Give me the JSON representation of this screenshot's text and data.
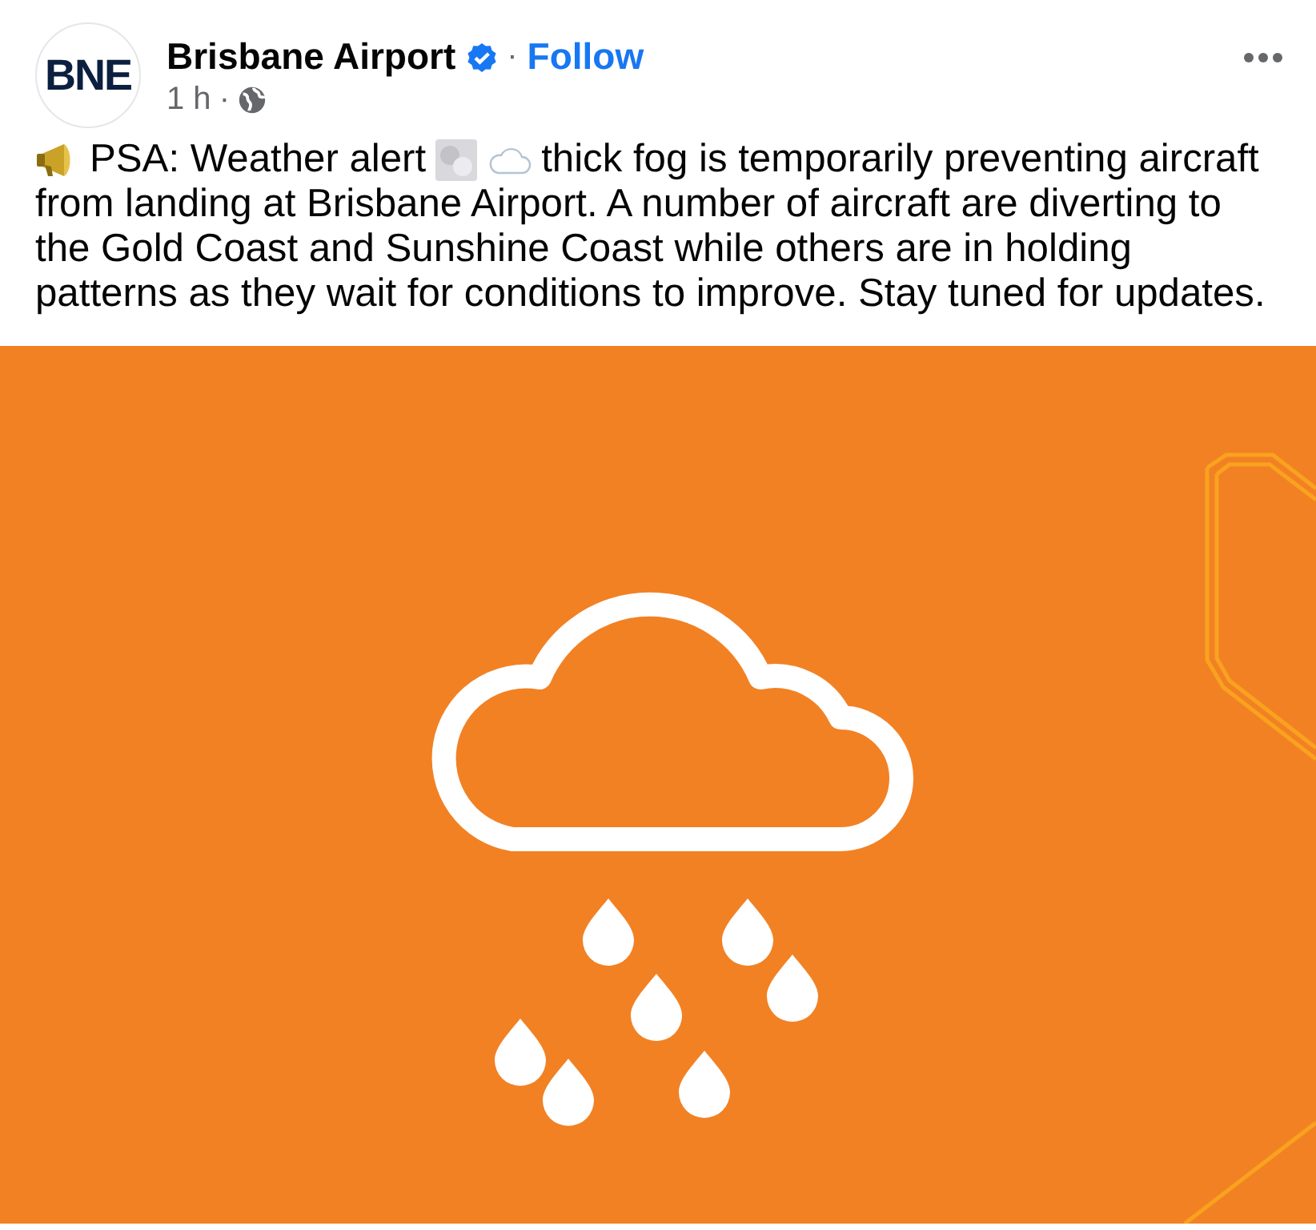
{
  "post": {
    "avatar_text": "BNE",
    "author": "Brisbane Airport",
    "verified": true,
    "follow_separator": "·",
    "follow_label": "Follow",
    "time": "1 h",
    "time_separator": "·",
    "lead": "PSA: Weather alert",
    "lead_rest": "thick fog is temporarily preventing aircraft",
    "body": "from landing at Brisbane Airport. A number of aircraft are diverting to the Gold Coast and Sunshine Coast while others are in holding patterns as they wait for conditions to improve. Stay tuned for updates."
  }
}
